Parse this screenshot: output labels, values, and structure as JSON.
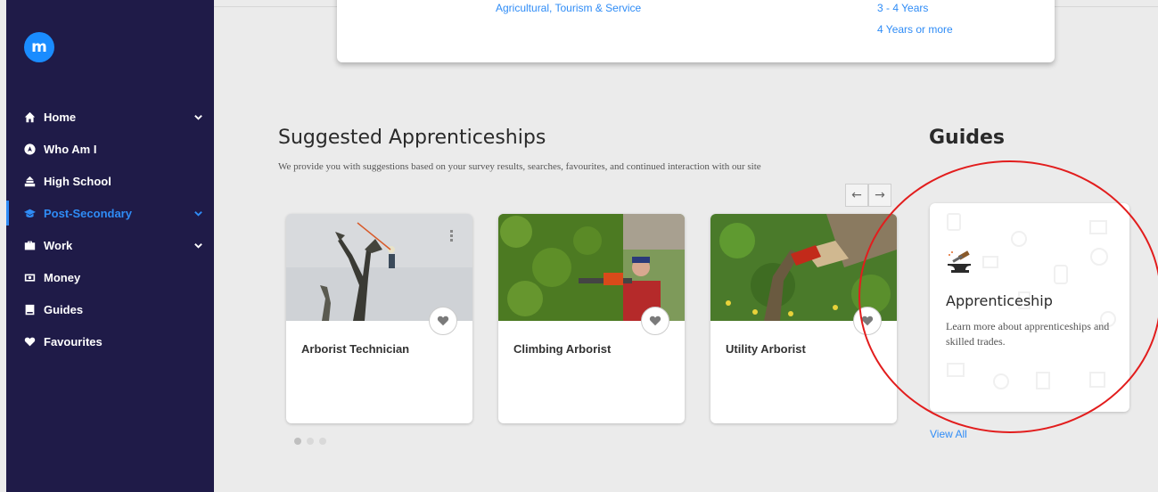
{
  "sidebar": {
    "logo": "m",
    "items": [
      {
        "label": "Home",
        "icon": "home-icon",
        "has_chevron": true
      },
      {
        "label": "Who Am I",
        "icon": "compass-icon",
        "has_chevron": false
      },
      {
        "label": "High School",
        "icon": "school-icon",
        "has_chevron": false
      },
      {
        "label": "Post-Secondary",
        "icon": "graduation-cap-icon",
        "has_chevron": true,
        "active": true
      },
      {
        "label": "Work",
        "icon": "briefcase-icon",
        "has_chevron": true
      },
      {
        "label": "Money",
        "icon": "money-icon",
        "has_chevron": false
      },
      {
        "label": "Guides",
        "icon": "book-icon",
        "has_chevron": false
      },
      {
        "label": "Favourites",
        "icon": "heart-icon",
        "has_chevron": false
      }
    ]
  },
  "top_card": {
    "left_link": "Agricultural, Tourism & Service",
    "right_links": [
      "3 - 4 Years",
      "4 Years or more"
    ]
  },
  "suggested": {
    "title": "Suggested Apprenticeships",
    "subtitle": "We provide you with suggestions based on your survey results, searches, favourites, and continued interaction with our site",
    "prev_arrow": "←",
    "next_arrow": "→",
    "cards": [
      {
        "title": "Arborist Technician"
      },
      {
        "title": "Climbing Arborist"
      },
      {
        "title": "Utility Arborist"
      }
    ]
  },
  "guides": {
    "title": "Guides",
    "card_title": "Apprenticeship",
    "card_desc": "Learn more about apprenticeships and skilled trades.",
    "view_all": "View All"
  },
  "colors": {
    "sidebar_bg": "#1f1b48",
    "accent": "#2f8cf6",
    "annotation_circle": "#e21d1d"
  }
}
